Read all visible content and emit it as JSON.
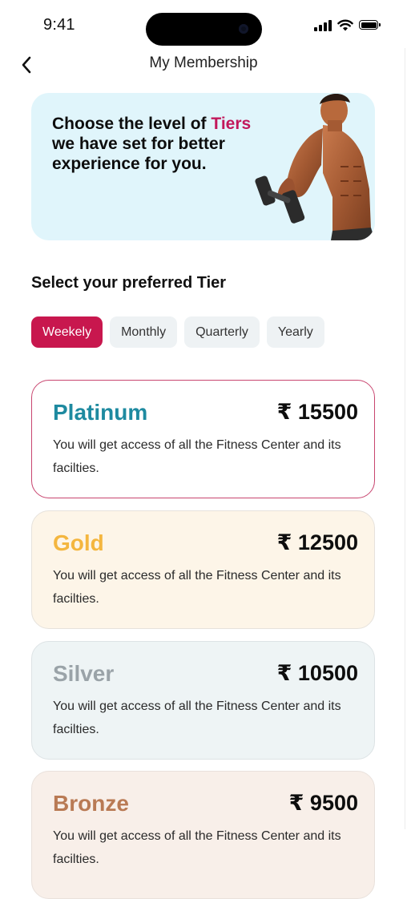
{
  "status_bar": {
    "time": "9:41"
  },
  "header": {
    "title": "My Membership",
    "back_icon": "chevron-left-icon"
  },
  "hero": {
    "text_before": "Choose the level of ",
    "text_highlight": "Tiers",
    "text_after": " we have set for better experience for you.",
    "highlight_color": "#c2185b",
    "background_color": "#e0f5fb"
  },
  "tier_selector": {
    "title": "Select your preferred Tier",
    "tabs": [
      {
        "label": "Weekely",
        "selected": true
      },
      {
        "label": "Monthly",
        "selected": false
      },
      {
        "label": "Quarterly",
        "selected": false
      },
      {
        "label": "Yearly",
        "selected": false
      }
    ],
    "active_color": "#c8174e"
  },
  "tiers": [
    {
      "name": "Platinum",
      "price": "₹ 15500",
      "description": "You will get access of all the Fitness Center and its facilties.",
      "name_color": "#1e8aa0",
      "selected": true
    },
    {
      "name": "Gold",
      "price": "₹ 12500",
      "description": "You will get access of all the Fitness Center and its facilties.",
      "name_color": "#f4b63f",
      "selected": false
    },
    {
      "name": "Silver",
      "price": "₹ 10500",
      "description": "You will get access of all the Fitness Center and its facilties.",
      "name_color": "#9aa3a8",
      "selected": false
    },
    {
      "name": "Bronze",
      "price": "₹ 9500",
      "description": "You will get access of all the Fitness Center and its facilties.",
      "name_color": "#b97a54",
      "selected": false
    }
  ]
}
